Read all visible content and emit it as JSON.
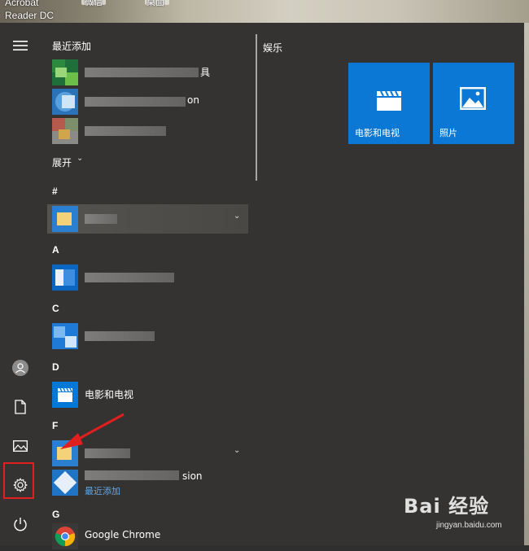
{
  "desktop": {
    "icon_text": "Acrobat\nReader DC",
    "label_1": "微信",
    "label_2": "桌面"
  },
  "rail": {
    "menu_icon": "hamburger-icon",
    "user_icon": "user-icon",
    "documents_icon": "document-icon",
    "pictures_icon": "picture-icon",
    "settings_icon": "gear-icon",
    "power_icon": "power-icon"
  },
  "list": {
    "recent_header": "最近添加",
    "recent_items": [
      {
        "visible_text": "具"
      },
      {
        "visible_text": "on"
      },
      {
        "visible_text": ""
      }
    ],
    "expand_label": "展开",
    "expand_icon": "chevron-down-icon",
    "letters": {
      "hash": "#",
      "a": "A",
      "c": "C",
      "d": "D",
      "f": "F",
      "g": "G"
    },
    "movies_tv": "电影和电视",
    "f_item_2_visible": "sion",
    "f_item_2_sub": "最近添加",
    "google_chrome": "Google Chrome"
  },
  "tiles": {
    "group_title": "娱乐",
    "movies_tv_label": "电影和电视",
    "photos_label": "照片"
  },
  "watermark": {
    "logo": "Bai 经验",
    "url": "jingyan.baidu.com"
  },
  "colors": {
    "accent": "#0078d7",
    "menu_bg": "#353331",
    "highlight": "#e11f1f"
  }
}
